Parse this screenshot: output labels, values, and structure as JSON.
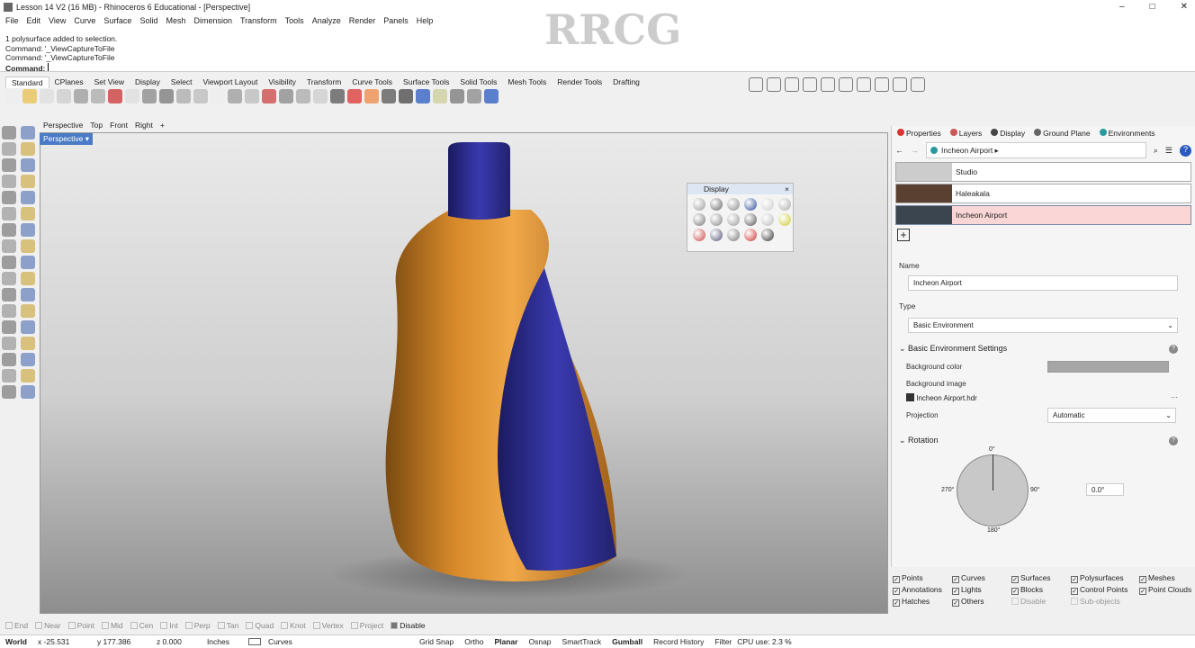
{
  "window": {
    "title": "Lesson 14  V2 (16 MB) - Rhinoceros 6 Educational - [Perspective]",
    "min": "–",
    "max": "□",
    "close": "✕"
  },
  "menu": [
    "File",
    "Edit",
    "View",
    "Curve",
    "Surface",
    "Solid",
    "Mesh",
    "Dimension",
    "Transform",
    "Tools",
    "Analyze",
    "Render",
    "Panels",
    "Help"
  ],
  "command": {
    "history": [
      "1 polysurface added to selection.",
      "Command: '_ViewCaptureToFile",
      "Command: '_ViewCaptureToFile"
    ],
    "prompt": "Command:"
  },
  "toolbar_tabs": [
    "Standard",
    "CPlanes",
    "Set View",
    "Display",
    "Select",
    "Viewport Layout",
    "Visibility",
    "Transform",
    "Curve Tools",
    "Surface Tools",
    "Solid Tools",
    "Mesh Tools",
    "Render Tools",
    "Drafting"
  ],
  "viewport_tabs": [
    "Perspective",
    "Top",
    "Front",
    "Right",
    "+"
  ],
  "viewport": {
    "label": "Perspective ▾"
  },
  "display_panel": {
    "title": "Display"
  },
  "panel": {
    "tabs": [
      "Properties",
      "Layers",
      "Display",
      "Ground Plane",
      "Environments"
    ],
    "breadcrumb": "Incheon Airport ▸",
    "environments": [
      "Studio",
      "Haleakala",
      "Incheon Airport"
    ],
    "add": "+",
    "name_label": "Name",
    "name_value": "Incheon Airport",
    "type_label": "Type",
    "type_value": "Basic Environment",
    "basic_section": "Basic Environment Settings",
    "bg_color_label": "Background color",
    "bg_color": "#a6a6a6",
    "bg_image_label": "Background image",
    "bg_image": "Incheon Airport.hdr",
    "projection_label": "Projection",
    "projection_value": "Automatic",
    "rotation_section": "Rotation",
    "dial": {
      "top": "0°",
      "right": "90°",
      "bottom": "180°",
      "left": "270°"
    },
    "rotation_value": "0.0°"
  },
  "object_filters": [
    {
      "label": "Points",
      "checked": true
    },
    {
      "label": "Curves",
      "checked": true
    },
    {
      "label": "Surfaces",
      "checked": true
    },
    {
      "label": "Polysurfaces",
      "checked": true
    },
    {
      "label": "Meshes",
      "checked": true
    },
    {
      "label": "Annotations",
      "checked": true
    },
    {
      "label": "Lights",
      "checked": true
    },
    {
      "label": "Blocks",
      "checked": true
    },
    {
      "label": "Control Points",
      "checked": true
    },
    {
      "label": "Point Clouds",
      "checked": true
    },
    {
      "label": "Hatches",
      "checked": true
    },
    {
      "label": "Others",
      "checked": true
    },
    {
      "label": "Disable",
      "checked": false
    },
    {
      "label": "Sub-objects",
      "checked": false
    }
  ],
  "osnap": [
    "End",
    "Near",
    "Point",
    "Mid",
    "Cen",
    "Int",
    "Perp",
    "Tan",
    "Quad",
    "Knot",
    "Vertex",
    "Project",
    "Disable"
  ],
  "status": {
    "cplane": "World",
    "x": "x -25.531",
    "y": "y 177.386",
    "z": "z 0.000",
    "units": "Inches",
    "layer": "Curves",
    "items": [
      "Grid Snap",
      "Ortho",
      "Planar",
      "Osnap",
      "SmartTrack",
      "Gumball",
      "Record History",
      "Filter"
    ],
    "cpu": "CPU use: 2.3 %"
  },
  "watermark": "RRCG"
}
